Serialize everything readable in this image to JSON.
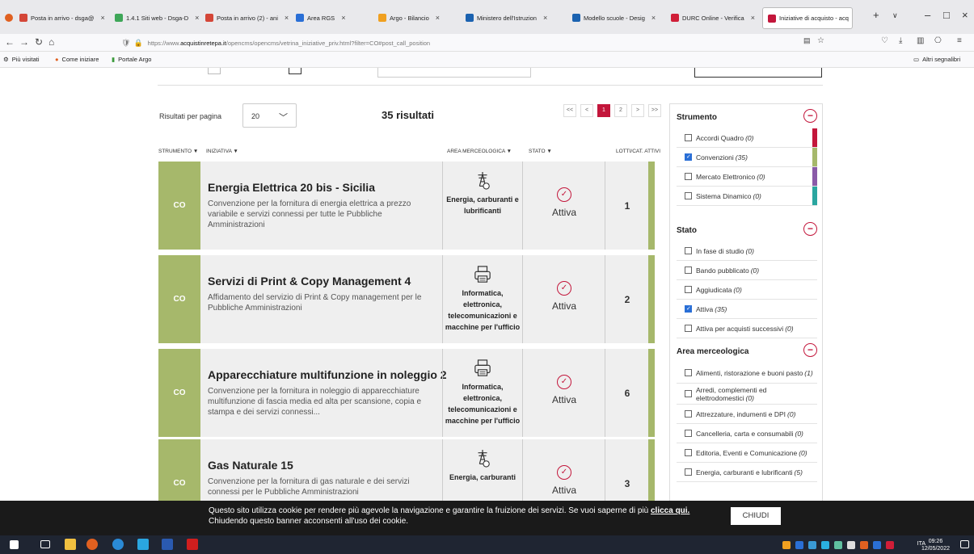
{
  "browser": {
    "tabs": [
      {
        "label": "Posta in arrivo - dsga@",
        "color": "#d44638"
      },
      {
        "label": "1.4.1 Siti web - Dsga-D",
        "color": "#3ea658"
      },
      {
        "label": "Posta in arrivo (2) - ani",
        "color": "#d44638"
      },
      {
        "label": "Area RGS",
        "color": "#2a6fd6"
      },
      {
        "label": "Argo - Bilancio",
        "color": "#f0a020"
      },
      {
        "label": "Ministero dell'Istruzion",
        "color": "#1b62b0"
      },
      {
        "label": "Modello scuole - Desig",
        "color": "#1b62b0"
      },
      {
        "label": "DURC Online - Verifica",
        "color": "#d01e38"
      },
      {
        "label": "Iniziative di acquisto - acq",
        "color": "#c3163b"
      }
    ],
    "url_prefix": "https://www.",
    "url_domain": "acquistinretepa.it",
    "url_path": "/opencms/opencms/vetrina_iniziative_priv.html?filter=CO#post_call_position",
    "bookmarks": [
      "Più visitati",
      "Come iniziare",
      "Portale Argo"
    ],
    "other_bookmarks": "Altri segnalibri"
  },
  "listing": {
    "rpp_label": "Risultati per pagina",
    "rpp_value": "20",
    "results": "35 risultati",
    "pager": [
      "<<",
      "<",
      "1",
      "2",
      ">",
      ">>"
    ],
    "columns": {
      "strumento": "STRUMENTO ▼",
      "iniziativa": "INIZIATIVA ▼",
      "area": "AREA MERCEOLOGICA ▼",
      "stato": "STATO ▼",
      "lotti": "LOTTI/CAT. ATTIVI"
    }
  },
  "rows": [
    {
      "code": "CO",
      "title": "Energia Elettrica 20 bis - Sicilia",
      "desc": "Convenzione per la fornitura di energia elettrica a prezzo variabile e servizi connessi per tutte le Pubbliche Amministrazioni",
      "area": "Energia, carburanti e lubrificanti",
      "icon": "energy-tower-icon",
      "stato": "Attiva",
      "lotti": "1"
    },
    {
      "code": "CO",
      "title": "Servizi di Print & Copy Management 4",
      "desc": "Affidamento del servizio di Print & Copy management per le Pubbliche Amministrazioni",
      "area": "Informatica, elettronica, telecomunicazioni e macchine per l'ufficio",
      "icon": "printer-icon",
      "stato": "Attiva",
      "lotti": "2"
    },
    {
      "code": "CO",
      "title": "Apparecchiature multifunzione in noleggio 2",
      "desc": "Convenzione per la fornitura in noleggio di apparecchiature multifunzione di fascia media ed alta per scansione, copia e stampa e dei servizi connessi...",
      "area": "Informatica, elettronica, telecomunicazioni e macchine per l'ufficio",
      "icon": "printer-icon",
      "stato": "Attiva",
      "lotti": "6"
    },
    {
      "code": "CO",
      "title": "Gas Naturale 15",
      "desc": "Convenzione per la fornitura di gas naturale e dei servizi connessi per le Pubbliche Amministrazioni",
      "area": "Energia, carburanti",
      "icon": "energy-tower-icon",
      "stato": "Attiva",
      "lotti": "3"
    }
  ],
  "sidebar": {
    "strumento": {
      "title": "Strumento",
      "items": [
        {
          "label": "Accordi Quadro",
          "count": "(0)",
          "checked": false,
          "bar": "#c3163b"
        },
        {
          "label": "Convenzioni",
          "count": "(35)",
          "checked": true,
          "bar": "#a6b86b"
        },
        {
          "label": "Mercato Elettronico",
          "count": "(0)",
          "checked": false,
          "bar": "#8a5aa8"
        },
        {
          "label": "Sistema Dinamico",
          "count": "(0)",
          "checked": false,
          "bar": "#2aa6a0"
        }
      ]
    },
    "stato": {
      "title": "Stato",
      "items": [
        {
          "label": "In fase di studio",
          "count": "(0)",
          "checked": false
        },
        {
          "label": "Bando pubblicato",
          "count": "(0)",
          "checked": false
        },
        {
          "label": "Aggiudicata",
          "count": "(0)",
          "checked": false
        },
        {
          "label": "Attiva",
          "count": "(35)",
          "checked": true
        },
        {
          "label": "Attiva per acquisti successivi",
          "count": "(0)",
          "checked": false
        }
      ]
    },
    "area": {
      "title": "Area merceologica",
      "items": [
        {
          "label": "Alimenti, ristorazione e buoni pasto",
          "count": "(1)",
          "checked": false
        },
        {
          "label": "Arredi, complementi ed elettrodomestici",
          "count": "(0)",
          "checked": false
        },
        {
          "label": "Attrezzature, indumenti e DPI",
          "count": "(0)",
          "checked": false
        },
        {
          "label": "Cancelleria, carta e consumabili",
          "count": "(0)",
          "checked": false
        },
        {
          "label": "Editoria, Eventi e Comunicazione",
          "count": "(0)",
          "checked": false
        },
        {
          "label": "Energia, carburanti e lubrificanti",
          "count": "(5)",
          "checked": false
        }
      ]
    }
  },
  "cookie": {
    "text": "Questo sito utilizza cookie per rendere più agevole la navigazione e garantire la fruizione dei servizi. Se vuoi saperne di più ",
    "link": "clicca qui.",
    "text2": "Chiudendo questo banner acconsenti all'uso dei cookie.",
    "button": "CHIUDI"
  },
  "taskbar": {
    "time": "09:26",
    "date": "12/05/2022",
    "lang": "ITA"
  }
}
